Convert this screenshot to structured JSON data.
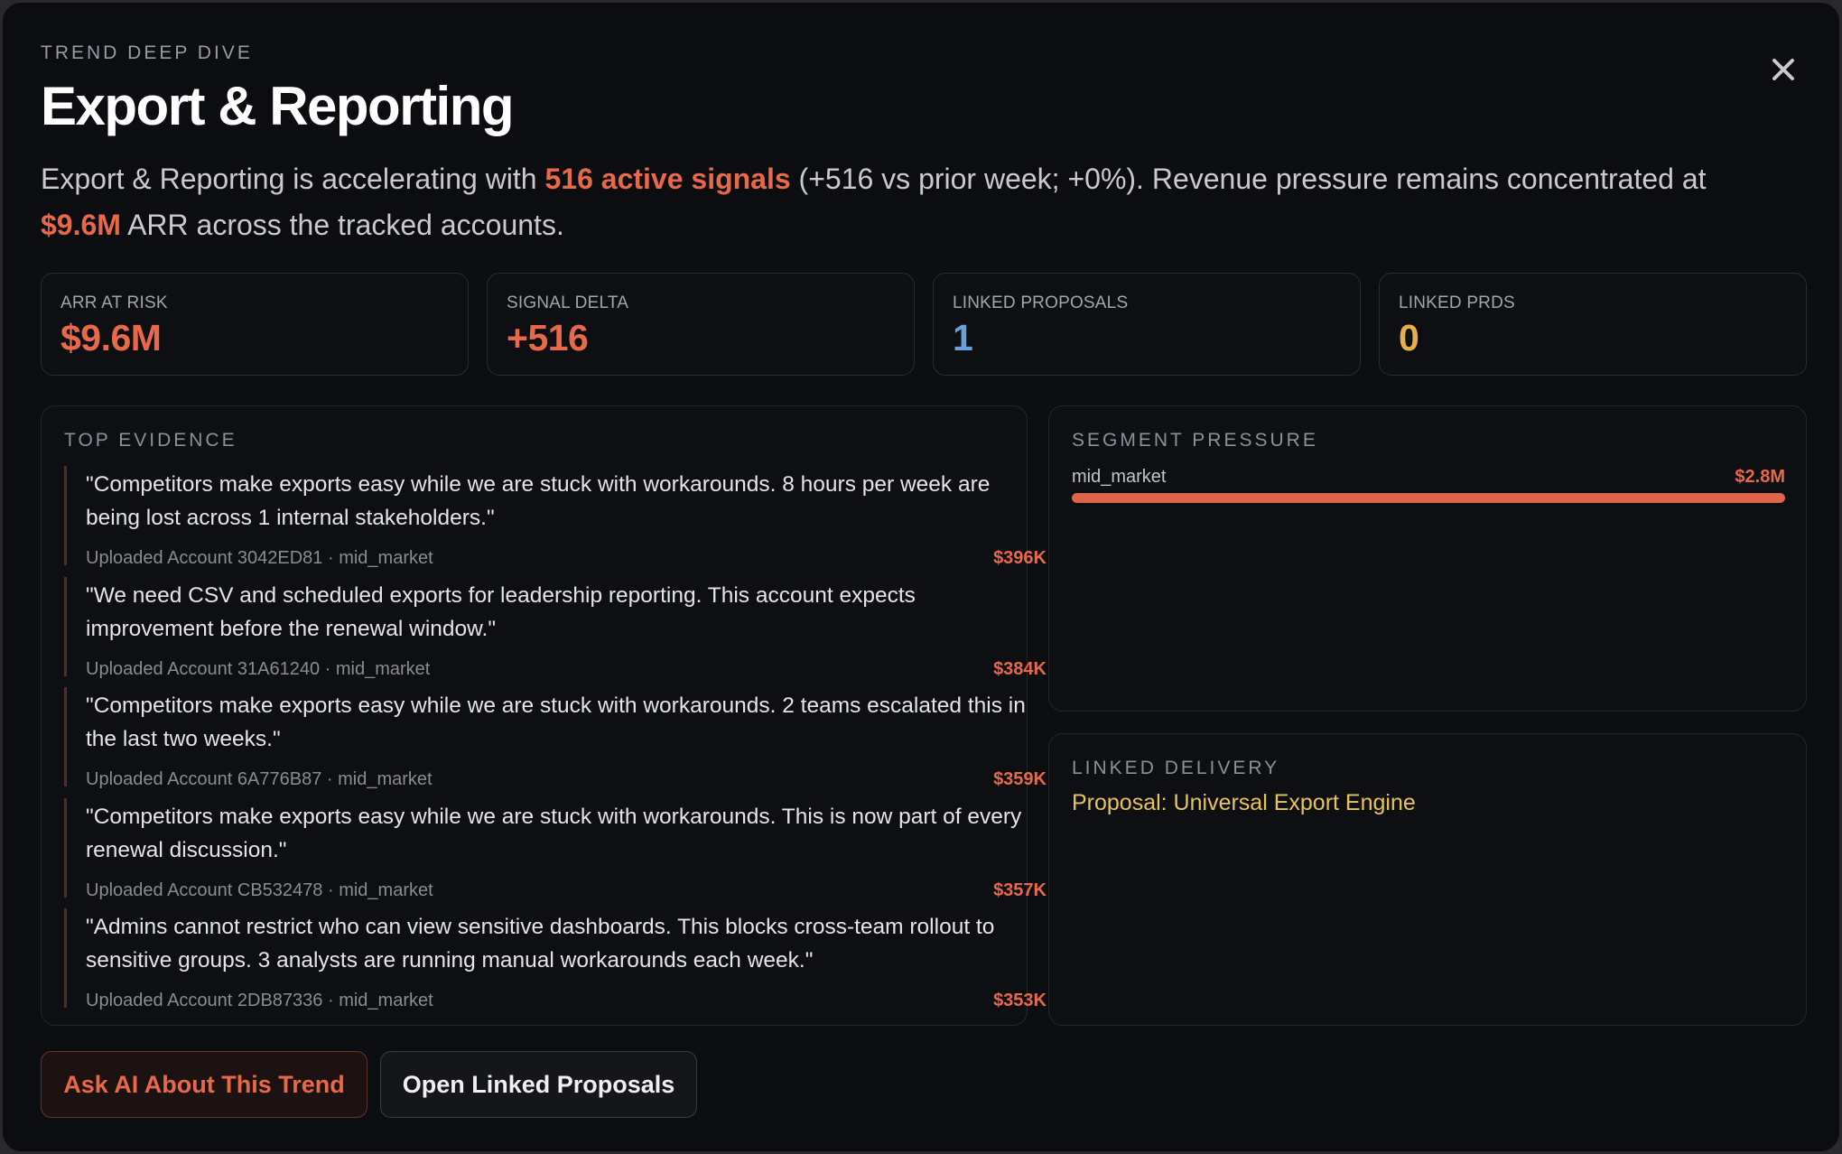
{
  "header": {
    "eyebrow": "TREND DEEP DIVE",
    "title": "Export & Reporting"
  },
  "summary": {
    "part1": "Export & Reporting is accelerating with ",
    "highlight1": "516 active signals",
    "part2": " (+516 vs prior week; +0%). Revenue pressure remains concentrated at ",
    "highlight2": "$9.6M",
    "part3": " ARR across the tracked accounts."
  },
  "stats": [
    {
      "label": "ARR AT RISK",
      "value": "$9.6M",
      "color": "#e8684a"
    },
    {
      "label": "SIGNAL DELTA",
      "value": "+516",
      "color": "#e8684a"
    },
    {
      "label": "LINKED PROPOSALS",
      "value": "1",
      "color": "#6aa0d8"
    },
    {
      "label": "LINKED PRDS",
      "value": "0",
      "color": "#e3b04b"
    }
  ],
  "evidence": {
    "title": "TOP EVIDENCE",
    "items": [
      {
        "quote": "\"Competitors make exports easy while we are stuck with workarounds. 8 hours per week are being lost across 1 internal stakeholders.\"",
        "source": "Uploaded Account 3042ED81 · mid_market",
        "amount": "$396K"
      },
      {
        "quote": "\"We need CSV and scheduled exports for leadership reporting. This account expects improvement before the renewal window.\"",
        "source": "Uploaded Account 31A61240 · mid_market",
        "amount": "$384K"
      },
      {
        "quote": "\"Competitors make exports easy while we are stuck with workarounds. 2 teams escalated this in the last two weeks.\"",
        "source": "Uploaded Account 6A776B87 · mid_market",
        "amount": "$359K"
      },
      {
        "quote": "\"Competitors make exports easy while we are stuck with workarounds. This is now part of every renewal discussion.\"",
        "source": "Uploaded Account CB532478 · mid_market",
        "amount": "$357K"
      },
      {
        "quote": "\"Admins cannot restrict who can view sensitive dashboards. This blocks cross-team rollout to sensitive groups. 3 analysts are running manual workarounds each week.\"",
        "source": "Uploaded Account 2DB87336 · mid_market",
        "amount": "$353K"
      }
    ]
  },
  "segment": {
    "title": "SEGMENT PRESSURE",
    "items": [
      {
        "name": "mid_market",
        "amount": "$2.8M",
        "share": 1.0
      }
    ]
  },
  "delivery": {
    "title": "LINKED DELIVERY",
    "link": "Proposal: Universal Export Engine"
  },
  "actions": {
    "ask_ai": "Ask AI About This Trend",
    "open_proposals": "Open Linked Proposals"
  },
  "icons": {
    "close": "close-icon"
  }
}
